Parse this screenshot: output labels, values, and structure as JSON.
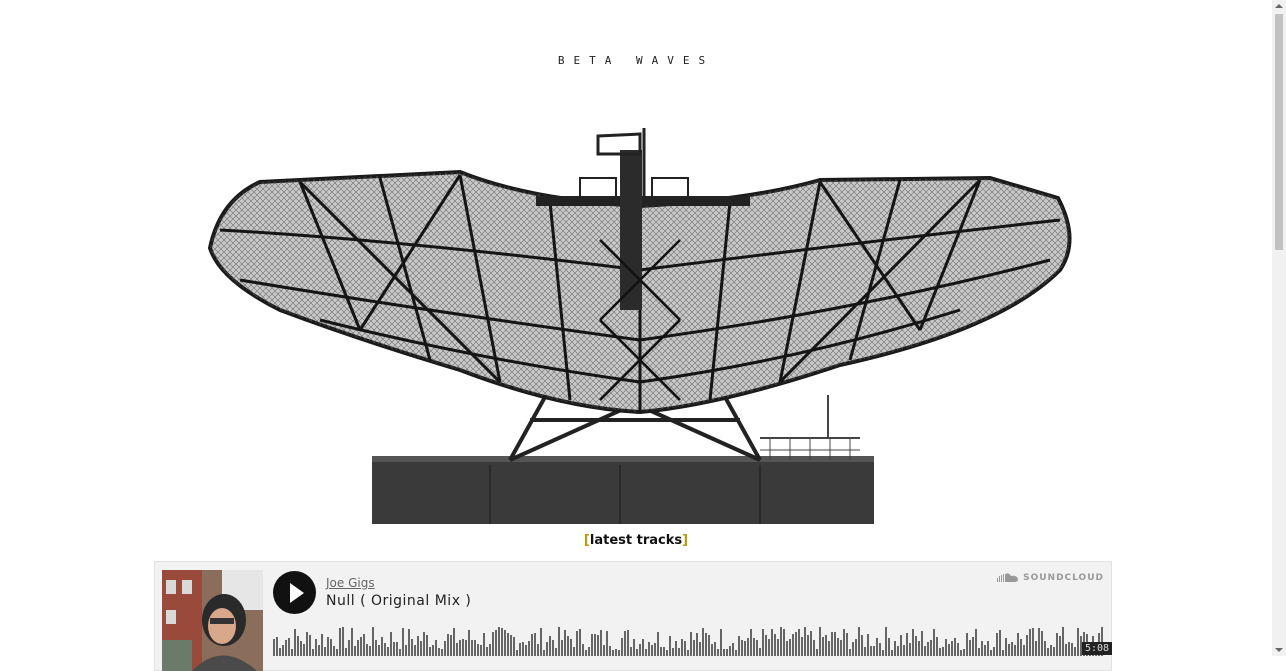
{
  "site": {
    "title": "BETA WAVES"
  },
  "section": {
    "prefix": "[",
    "label": "latest tracks",
    "suffix": "]"
  },
  "player": {
    "artist": "Joe Gigs",
    "track_title": "Null ( Original Mix )",
    "brand": "SOUNDCLOUD",
    "duration": "5:08",
    "state": "paused"
  }
}
